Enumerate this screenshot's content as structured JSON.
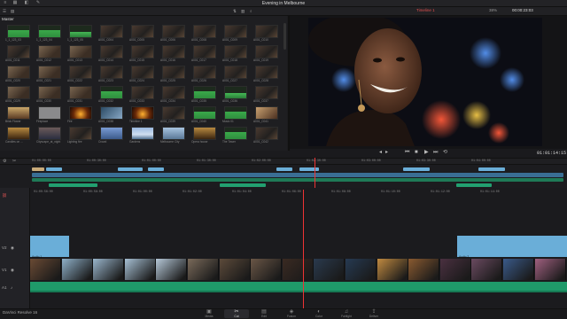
{
  "project_title": "Evening in Melbourne",
  "viewer": {
    "timeline_name": "Timeline 1",
    "timecode_top": "00:00:23:03",
    "zoom": "38%",
    "timecode": "01:01:14:15"
  },
  "media": {
    "bin_label": "Master",
    "grid_rows": [
      [
        "A",
        "A",
        "B",
        "C",
        "C",
        "C",
        "C",
        "C",
        "C"
      ],
      [
        "C",
        "D",
        "D",
        "C",
        "C",
        "C",
        "C",
        "C",
        "C"
      ],
      [
        "D",
        "D",
        "C",
        "C",
        "C",
        "C",
        "C",
        "C",
        "C"
      ],
      [
        "D",
        "D",
        "D",
        "A",
        "C",
        "C",
        "A",
        "B",
        "C"
      ],
      [
        "E",
        "F",
        "G",
        "H",
        "G",
        "C",
        "A",
        "A",
        "I"
      ],
      [
        "J",
        "K",
        "C",
        "L",
        "M",
        "N",
        "J",
        "A",
        "C"
      ]
    ],
    "labels": [
      [
        "1_1_123_03",
        "1_1_123_04",
        "1_1_123_05",
        "A001_C004",
        "A001_C005",
        "A001_C006",
        "A001_C008",
        "A001_C009",
        "A001_C010"
      ],
      [
        "A001_C011",
        "A001_C012",
        "A001_C013",
        "A001_C014",
        "A001_C015",
        "A001_C016",
        "A001_C017",
        "A001_C018",
        "A001_C019"
      ],
      [
        "A001_C020",
        "A001_C021",
        "A001_C022",
        "A001_C023",
        "A001_C024",
        "A001_C025",
        "A001_C026",
        "A001_C027",
        "A001_C028"
      ],
      [
        "A001_C029",
        "A001_C030",
        "A001_C031",
        "A001_C032",
        "A001_C033",
        "A001_C034",
        "A001_C035",
        "A001_C036",
        "A001_C037"
      ],
      [
        "Brick Flower",
        "Fireplace",
        "Fire",
        "A001_C038",
        "Timeline 1",
        "A001_C039",
        "A001_C040",
        "Music 01",
        "A001_C041"
      ],
      [
        "Candles on ...",
        "Cityscape_at_night",
        "Lighting fire",
        "Crowd",
        "Gardens",
        "Melbourne City",
        "Opera house",
        "The Tower",
        "A001_C042"
      ]
    ]
  },
  "ruler_top": [
    "01:00:00:00",
    "01:00:30:00",
    "01:01:00:00",
    "01:01:30:00",
    "01:02:00:00",
    "01:02:30:00",
    "01:03:00:00",
    "01:03:30:00",
    "01:04:00:00"
  ],
  "ruler_main": [
    "01:00:56:00",
    "01:00:58:00",
    "01:01:00:00",
    "01:01:02:00",
    "01:01:04:00",
    "01:01:06:00",
    "01:01:08:00",
    "01:01:10:00",
    "01:01:12:00",
    "01:01:14:00"
  ],
  "tracks": {
    "v2": "V2",
    "v1": "V1",
    "a1": "A1",
    "audio_label_1": "Audio 1",
    "audio_label_2": "Audio 2"
  },
  "pages": [
    "Media",
    "Cut",
    "Edit",
    "Fusion",
    "Color",
    "Fairlight",
    "Deliver"
  ],
  "active_page": "Cut",
  "app_name": "DaVinci Resolve 16",
  "colors": {
    "accent_blue": "#6aaed8",
    "audio_green": "#1f9a6a",
    "playhead": "#e33333",
    "clip_tan": "#c9ab7a"
  }
}
